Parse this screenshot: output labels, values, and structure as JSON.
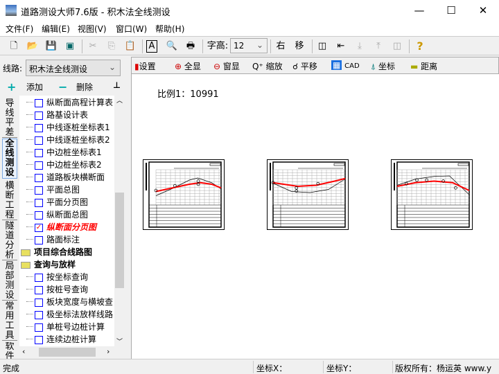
{
  "window": {
    "title": "道路测设大师7.6版 - 积木法全线测设",
    "minimize": "—",
    "maximize": "☐",
    "close": "✕"
  },
  "menu": [
    "文件(F)",
    "编辑(E)",
    "视图(V)",
    "窗口(W)",
    "帮助(H)"
  ],
  "toolbar": {
    "font_label": "字高:",
    "font_value": "12",
    "right_label": "右",
    "move_label": "移",
    "help": "?"
  },
  "left": {
    "line_label": "线路:",
    "line_value": "积木法全线测设",
    "add": "添加",
    "delete": "删除",
    "pin": "⊥",
    "tabs": [
      "导线平差",
      "全线测设",
      "横断工程",
      "隧道分析",
      "局部测设",
      "常用工具",
      "软件"
    ],
    "tree": [
      {
        "label": "纵断面高程计算表",
        "type": "item"
      },
      {
        "label": "路基设计表",
        "type": "item"
      },
      {
        "label": "中线逐桩坐标表1",
        "type": "item"
      },
      {
        "label": "中线逐桩坐标表2",
        "type": "item"
      },
      {
        "label": "中边桩坐标表1",
        "type": "item"
      },
      {
        "label": "中边桩坐标表2",
        "type": "item"
      },
      {
        "label": "道路板块横断面",
        "type": "item"
      },
      {
        "label": "平面总图",
        "type": "item"
      },
      {
        "label": "平面分页图",
        "type": "item"
      },
      {
        "label": "纵断面总图",
        "type": "item"
      },
      {
        "label": "纵断面分页图",
        "type": "checked"
      },
      {
        "label": "路面标注",
        "type": "item"
      },
      {
        "label": "项目综合线路图",
        "type": "folder"
      },
      {
        "label": "查询与放样",
        "type": "folder"
      },
      {
        "label": "按坐标查询",
        "type": "item"
      },
      {
        "label": "按桩号查询",
        "type": "item"
      },
      {
        "label": "板块宽度与横坡查",
        "type": "item"
      },
      {
        "label": "极坐标法放样线路",
        "type": "item"
      },
      {
        "label": "单桩号边桩计算",
        "type": "item"
      },
      {
        "label": "连续边桩计算",
        "type": "item"
      }
    ]
  },
  "viewtoolbar": [
    "设置",
    "全显",
    "窗显",
    "缩放",
    "平移",
    "CAD",
    "坐标",
    "距离"
  ],
  "canvas": {
    "scale": "比例1：10991"
  },
  "status": {
    "state": "完成",
    "x": "坐标X：",
    "y": "坐标Y：",
    "copyright": "版权所有：杨运英 www.y"
  },
  "colors": {
    "accent": "#ff0000",
    "checkbox": "#0000ff"
  }
}
